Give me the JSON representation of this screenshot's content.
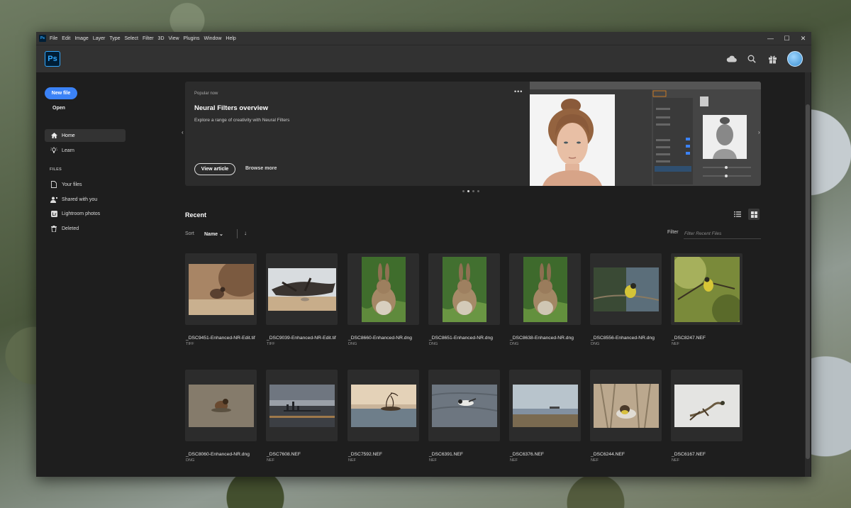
{
  "menu": [
    "File",
    "Edit",
    "Image",
    "Layer",
    "Type",
    "Select",
    "Filter",
    "3D",
    "View",
    "Plugins",
    "Window",
    "Help"
  ],
  "app": {
    "logo": "Ps"
  },
  "window_controls": [
    "—",
    "☐",
    "✕"
  ],
  "sidebar": {
    "new_file": "New file",
    "open": "Open",
    "nav": [
      {
        "label": "Home",
        "icon": "home-icon"
      },
      {
        "label": "Learn",
        "icon": "lightbulb-icon"
      }
    ],
    "files_heading": "FILES",
    "files": [
      {
        "label": "Your files",
        "icon": "document-icon"
      },
      {
        "label": "Shared with you",
        "icon": "people-icon"
      },
      {
        "label": "Lightroom photos",
        "icon": "lightroom-icon"
      },
      {
        "label": "Deleted",
        "icon": "trash-icon"
      }
    ]
  },
  "hero": {
    "eyebrow": "Popular now",
    "title": "Neural Filters overview",
    "description": "Explore a range of creativity with Neural Filters",
    "primary": "View article",
    "secondary": "Browse more",
    "more": "•••",
    "slides": 4,
    "active_slide": 1
  },
  "recent": {
    "heading": "Recent",
    "sort_label": "Sort",
    "sort_value": "Name",
    "filter_label": "Filter",
    "filter_placeholder": "Filter Recent Files",
    "files": [
      {
        "name": "_DSC9451-Enhanced-NR-Edit.tif",
        "type": "TIFF"
      },
      {
        "name": "_DSC9039-Enhanced-NR-Edit.tif",
        "type": "TIFF"
      },
      {
        "name": "_DSC8660-Enhanced-NR.dng",
        "type": "DNG"
      },
      {
        "name": "_DSC8651-Enhanced-NR.dng",
        "type": "DNG"
      },
      {
        "name": "_DSC8638-Enhanced-NR.dng",
        "type": "DNG"
      },
      {
        "name": "_DSC8556-Enhanced-NR.dng",
        "type": "DNG"
      },
      {
        "name": "_DSC8247.NEF",
        "type": "NEF"
      },
      {
        "name": "_DSC8060-Enhanced-NR.dng",
        "type": "DNG"
      },
      {
        "name": "_DSC7608.NEF",
        "type": "NEF"
      },
      {
        "name": "_DSC7592.NEF",
        "type": "NEF"
      },
      {
        "name": "_DSC6391.NEF",
        "type": "NEF"
      },
      {
        "name": "_DSC6376.NEF",
        "type": "NEF"
      },
      {
        "name": "_DSC6244.NEF",
        "type": "NEF"
      },
      {
        "name": "_DSC6167.NEF",
        "type": "NEF"
      }
    ]
  },
  "colors": {
    "accent": "#3b82f6",
    "app_bg": "#1e1e1e",
    "bar_bg": "#323232",
    "card_bg": "#2c2c2c",
    "ps_blue": "#31a8ff"
  }
}
